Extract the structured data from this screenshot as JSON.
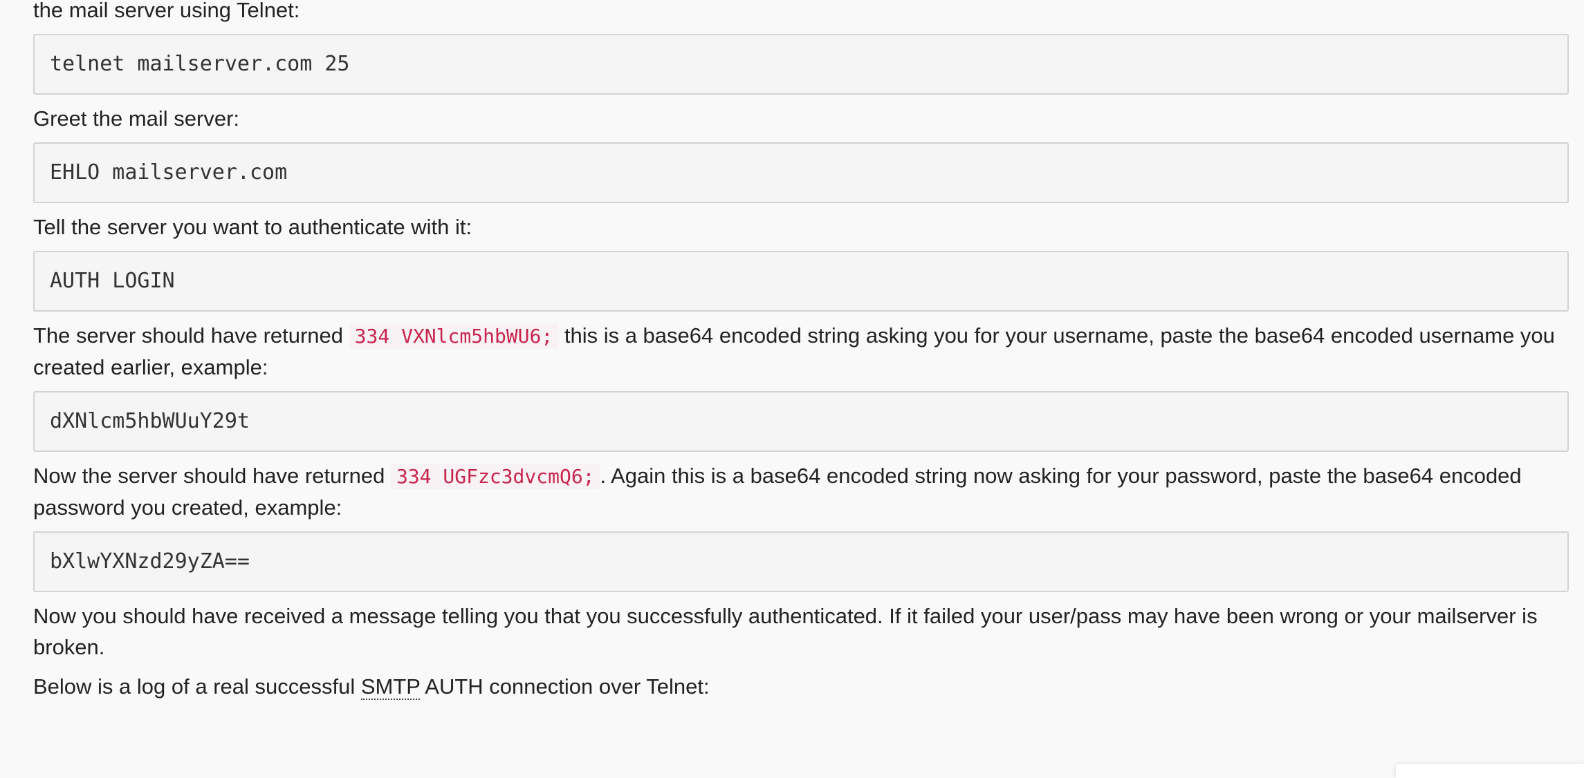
{
  "article": {
    "intro_tail": "the mail server using Telnet:",
    "cmd_telnet": "telnet mailserver.com 25",
    "greet": "Greet the mail server:",
    "cmd_ehlo": "EHLO mailserver.com",
    "auth_intro": "Tell the server you want to authenticate with it:",
    "cmd_auth": "AUTH LOGIN",
    "user_prompt_before": "The server should have returned ",
    "user_prompt_code": "334 VXNlcm5hbWU6;",
    "user_prompt_after": " this is a base64 encoded string asking you for your username, paste the base64 encoded username you created earlier, example:",
    "cmd_user": "dXNlcm5hbWUuY29t",
    "pass_prompt_before": "Now the server should have returned ",
    "pass_prompt_code": "334 UGFzc3dvcmQ6;",
    "pass_prompt_after": ". Again this is a base64 encoded string now asking for your password, paste the base64 encoded password you created, example:",
    "cmd_pass": "bXlwYXNzd29yZA==",
    "result": "Now you should have received a message telling you that you successfully authenticated. If it failed your user/pass may have been wrong or your mailserver is broken.",
    "log_before": "Below is a log of a real successful ",
    "log_abbr": "SMTP",
    "log_after": " AUTH connection over Telnet:"
  },
  "colors": {
    "inline_code_text": "#c7254e",
    "inline_code_bg": "#f9f2f4",
    "pre_bg": "#f5f5f5",
    "pre_border": "#d3d3d3",
    "page_bg": "#f9f9f9"
  }
}
